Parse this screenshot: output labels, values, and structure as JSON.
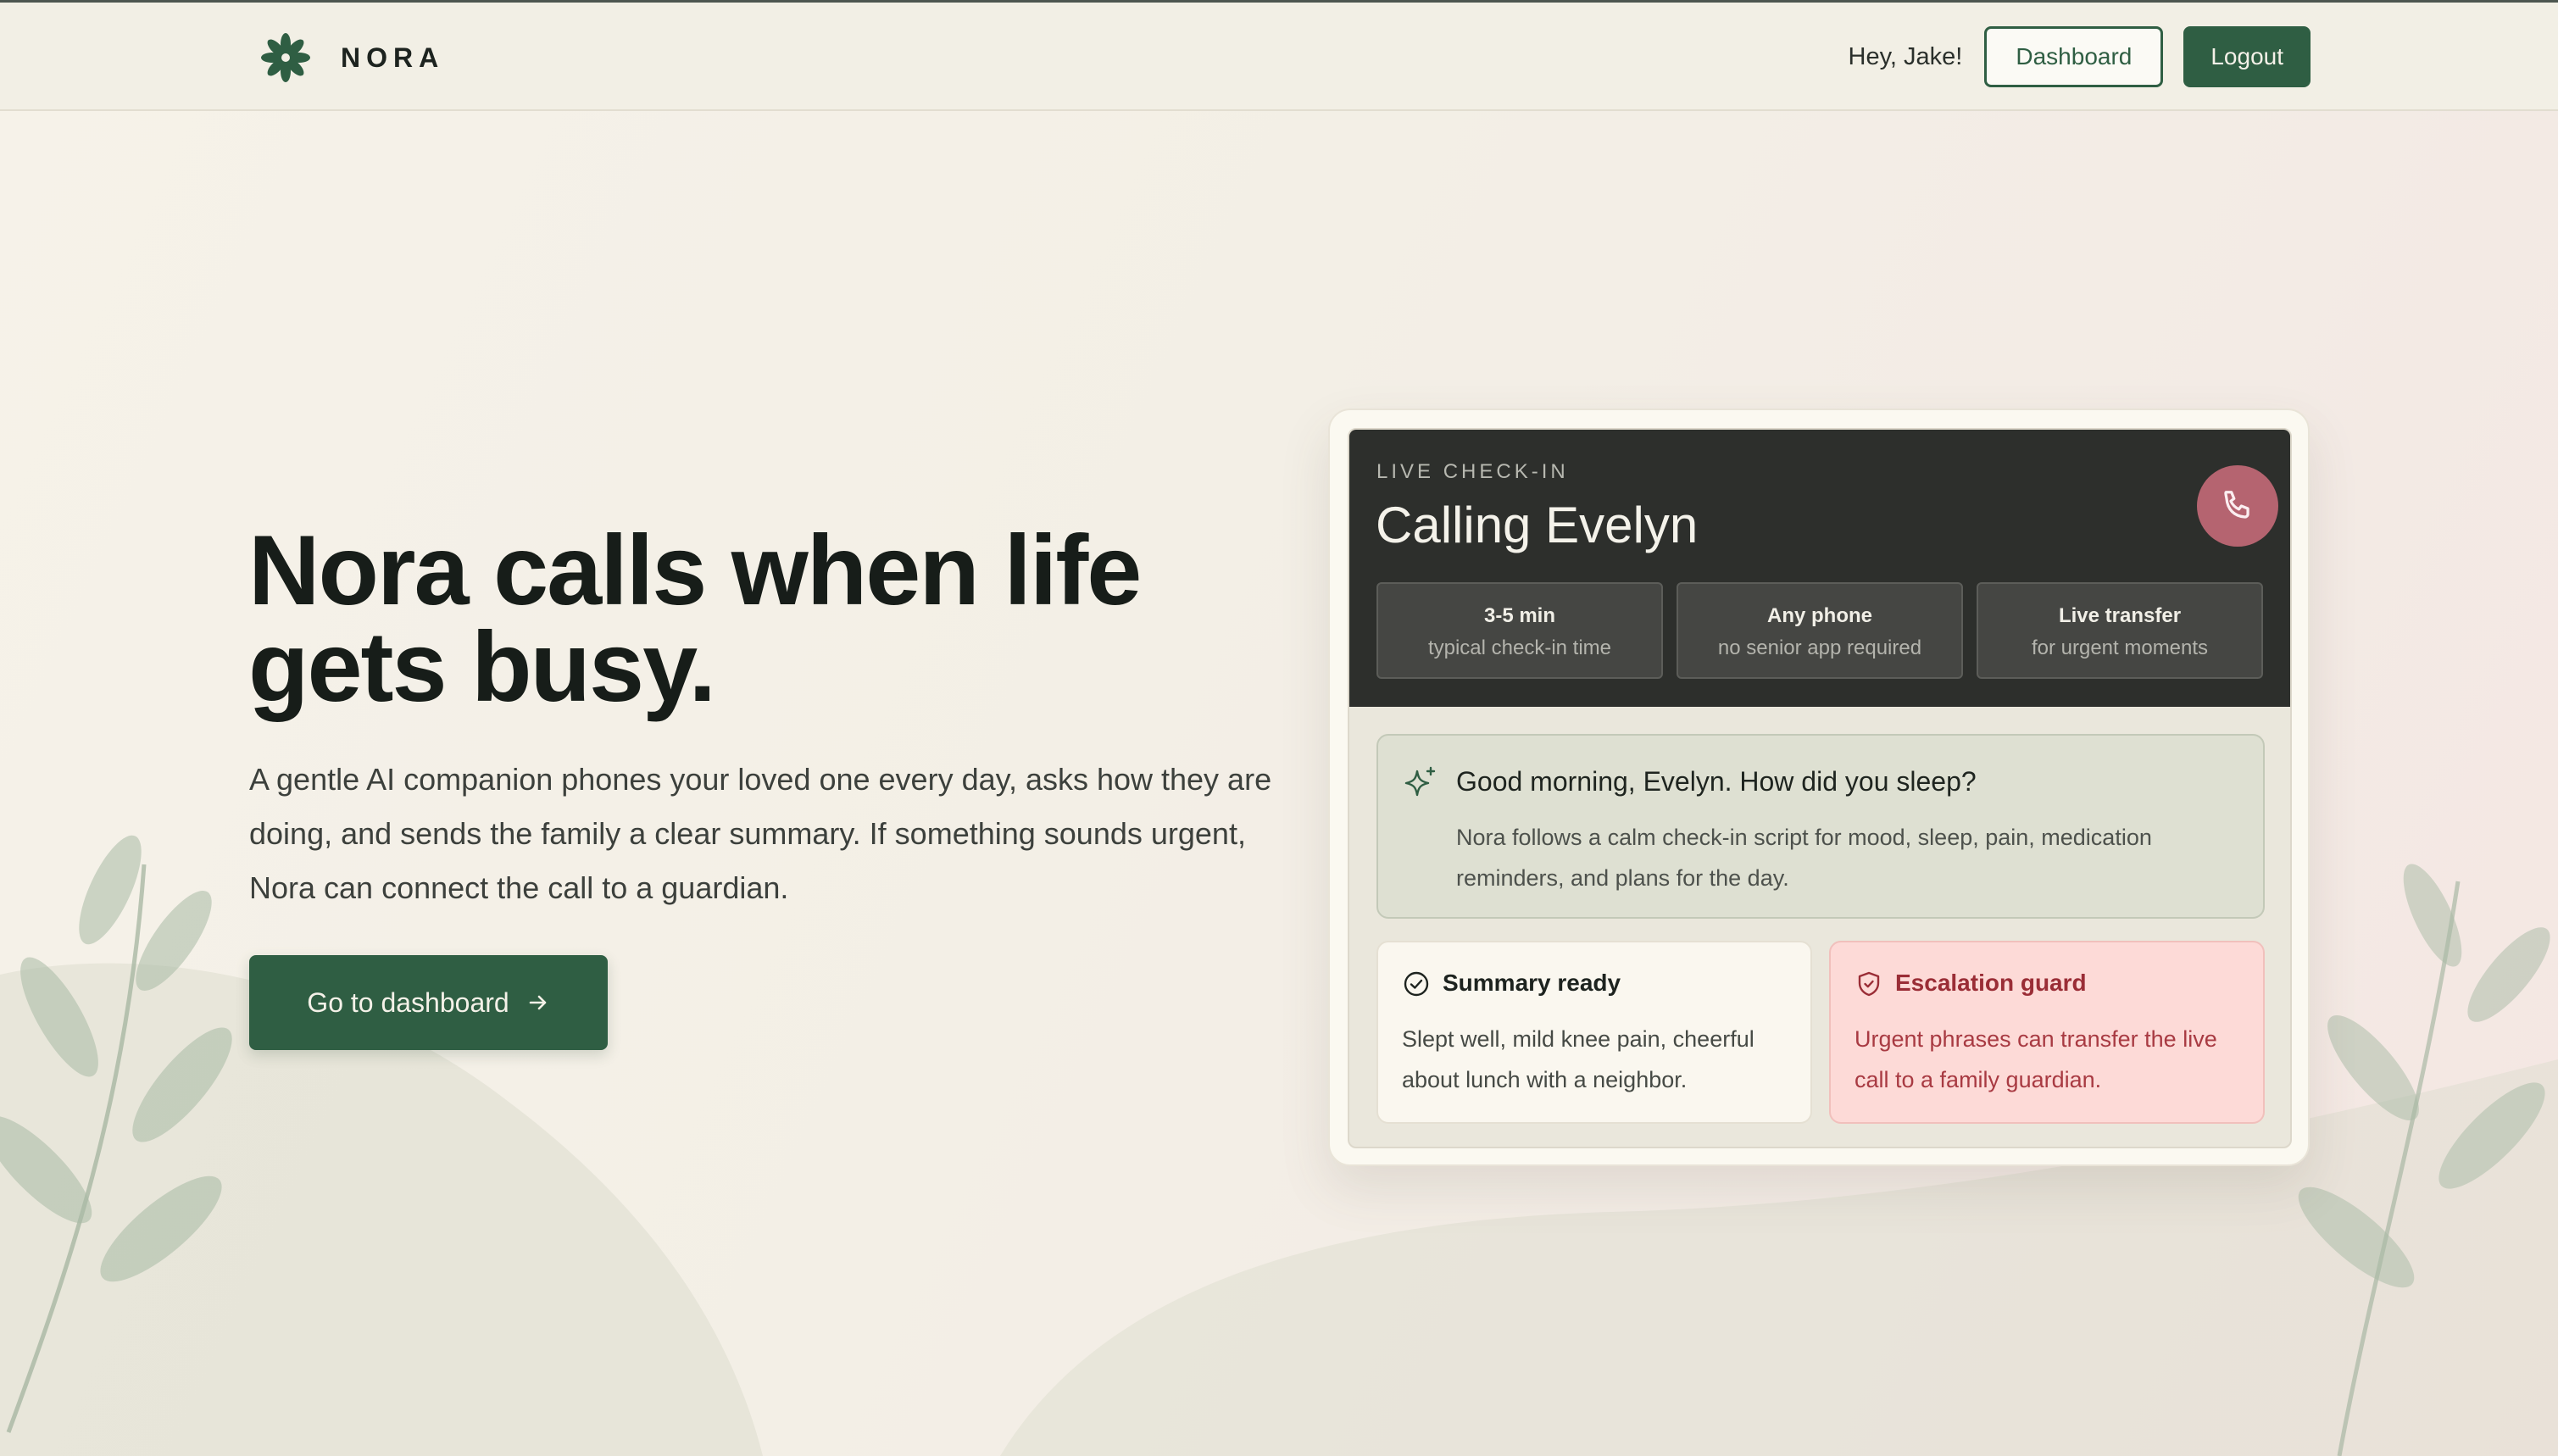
{
  "colors": {
    "brand_green": "#2f5e43",
    "dark_panel": "#2d2f2c",
    "phone_button": "#b56470",
    "escalation_text": "#9a2d36",
    "escalation_bg": "#fddad7"
  },
  "header": {
    "logo_icon": "flower-logo-icon",
    "brand": "NORA",
    "greeting": "Hey, Jake!",
    "dashboard_label": "Dashboard",
    "logout_label": "Logout"
  },
  "hero": {
    "title": "Nora calls when life gets busy.",
    "description": "A gentle AI companion phones your loved one every day, asks how they are doing, and sends the family a clear summary. If something sounds urgent, Nora can connect the call to a guardian.",
    "cta_label": "Go to dashboard",
    "cta_icon": "arrow-right-icon"
  },
  "card": {
    "live_label": "LIVE CHECK-IN",
    "title": "Calling Evelyn",
    "phone_icon": "phone-icon",
    "stats": [
      {
        "main": "3-5 min",
        "sub": "typical check-in time"
      },
      {
        "main": "Any phone",
        "sub": "no senior app required"
      },
      {
        "main": "Live transfer",
        "sub": "for urgent moments"
      }
    ],
    "greeting": {
      "icon": "sparkle-icon",
      "question": "Good morning, Evelyn. How did you sleep?",
      "description": "Nora follows a calm check-in script for mood, sleep, pain, medication reminders, and plans for the day."
    },
    "summary": {
      "icon": "check-circle-icon",
      "title": "Summary ready",
      "body": "Slept well, mild knee pain, cheerful about lunch with a neighbor."
    },
    "escalation": {
      "icon": "shield-icon",
      "title": "Escalation guard",
      "body": "Urgent phrases can transfer the live call to a family guardian."
    }
  }
}
